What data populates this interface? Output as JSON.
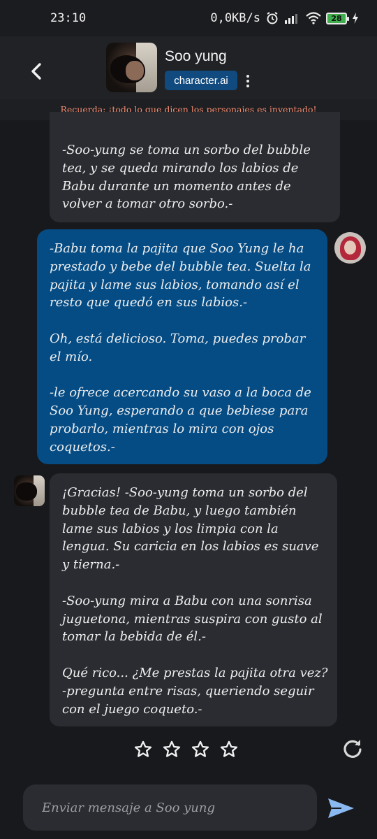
{
  "status_bar": {
    "time": "23:10",
    "network_speed": "0,0KB/s",
    "battery_level": "28",
    "icons": [
      "alarm-icon",
      "signal-icon",
      "wifi-icon",
      "battery-icon",
      "charging-icon"
    ]
  },
  "header": {
    "character_name": "Soo yung",
    "brand": "character.ai",
    "icons": [
      "back-arrow-icon",
      "more-vertical-icon"
    ]
  },
  "disclaimer": "Recuerda: ¡todo lo que dicen los personajes es inventado!",
  "messages": [
    {
      "role": "character",
      "text": "-Soo-yung se toma un sorbo del bubble tea, y se queda mirando los labios de Babu durante un momento antes de volver a tomar otro sorbo.-"
    },
    {
      "role": "user",
      "text": "-Babu toma la pajita que Soo Yung le ha prestado y bebe del bubble tea. Suelta la pajita y lame sus labios, tomando así el resto que quedó en sus labios.-\n\nOh, está delicioso. Toma, puedes probar el mío.\n\n-le ofrece acercando su vaso a la boca de Soo Yung, esperando a que bebiese para probarlo, mientras lo mira con ojos coquetos.-"
    },
    {
      "role": "character",
      "text": "¡Gracias! -Soo-yung toma un sorbo del bubble tea de Babu, y luego también lame sus labios y los limpia con la lengua. Su caricia en los labios es suave y tierna.-\n\n-Soo-yung mira a Babu con una sonrisa juguetona, mientras suspira con gusto al tomar la bebida de él.-\n\nQué rico... ¿Me prestas la pajita otra vez? -pregunta entre risas, queriendo seguir con el juego coqueto.-"
    }
  ],
  "rating": {
    "stars_total": 4,
    "stars_filled": 0
  },
  "composer": {
    "placeholder": "Enviar mensaje a Soo yung",
    "value": ""
  },
  "colors": {
    "background": "#18191c",
    "character_bubble": "#2a2c31",
    "user_bubble": "#054c85",
    "brand_badge": "#104a7e",
    "disclaimer_text": "#f08a70",
    "send_icon": "#8ab8f0"
  }
}
